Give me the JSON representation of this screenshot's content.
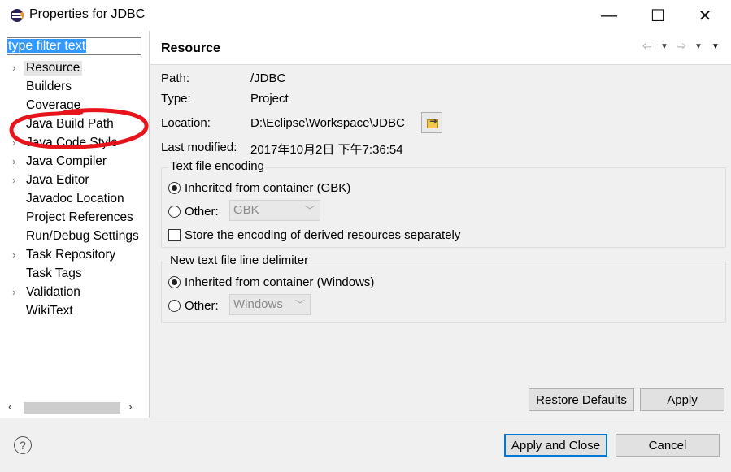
{
  "window": {
    "title": "Properties for JDBC",
    "minimize": "—",
    "maximize": "☐",
    "close": "✕"
  },
  "sidebar": {
    "filter_text": "type filter text",
    "items": [
      {
        "label": "Resource",
        "expandable": true,
        "selected": true
      },
      {
        "label": "Builders",
        "expandable": false
      },
      {
        "label": "Coverage",
        "expandable": false
      },
      {
        "label": "Java Build Path",
        "expandable": false
      },
      {
        "label": "Java Code Style",
        "expandable": true
      },
      {
        "label": "Java Compiler",
        "expandable": true
      },
      {
        "label": "Java Editor",
        "expandable": true
      },
      {
        "label": "Javadoc Location",
        "expandable": false
      },
      {
        "label": "Project References",
        "expandable": false
      },
      {
        "label": "Run/Debug Settings",
        "expandable": false
      },
      {
        "label": "Task Repository",
        "expandable": true
      },
      {
        "label": "Task Tags",
        "expandable": false
      },
      {
        "label": "Validation",
        "expandable": true
      },
      {
        "label": "WikiText",
        "expandable": false
      }
    ]
  },
  "page": {
    "title": "Resource",
    "path_label": "Path:",
    "path_value": "/JDBC",
    "type_label": "Type:",
    "type_value": "Project",
    "location_label": "Location:",
    "location_value": "D:\\Eclipse\\Workspace\\JDBC",
    "modified_label": "Last modified:",
    "modified_value": "2017年10月2日 下午7:36:54",
    "encoding": {
      "title": "Text file encoding",
      "inherited_label": "Inherited from container (GBK)",
      "other_label": "Other:",
      "other_value": "GBK",
      "store_label": "Store the encoding of derived resources separately"
    },
    "delimiter": {
      "title": "New text file line delimiter",
      "inherited_label": "Inherited from container (Windows)",
      "other_label": "Other:",
      "other_value": "Windows"
    },
    "restore_defaults": "Restore Defaults",
    "apply": "Apply"
  },
  "footer": {
    "help": "?",
    "apply_close": "Apply and Close",
    "cancel": "Cancel"
  },
  "colors": {
    "selection": "#3399ff",
    "annotation": "#e8141b",
    "default_button_border": "#0078d7"
  }
}
